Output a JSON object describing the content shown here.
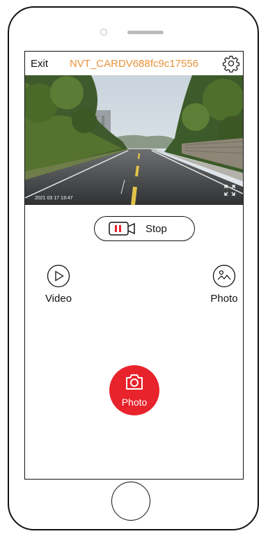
{
  "app": {
    "exit_label": "Exit",
    "ssid": "NVT_CARDV688fc9c17556"
  },
  "feed": {
    "timestamp": "2021 03 17  13:47"
  },
  "record": {
    "stop_label": "Stop"
  },
  "modes": {
    "video_label": "Video",
    "photo_label": "Photo"
  },
  "shutter": {
    "label": "Photo"
  },
  "colors": {
    "accent_orange": "#e8933a",
    "record_red": "#e8232b"
  }
}
